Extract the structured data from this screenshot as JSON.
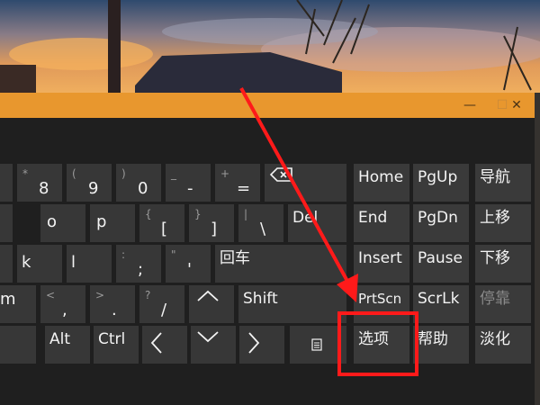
{
  "window": {
    "minimize": "—",
    "maximize": "☐",
    "close": "✕"
  },
  "keys": {
    "asterisk_8": {
      "top": "*",
      "main": "8"
    },
    "paren_9": {
      "top": "(",
      "main": "9"
    },
    "paren_0": {
      "top": ")",
      "main": "0"
    },
    "minus": {
      "top": "_",
      "main": "-"
    },
    "equals": {
      "top": "+",
      "main": "="
    },
    "o": "o",
    "p": "p",
    "bracket_left": {
      "top": "{",
      "main": "["
    },
    "bracket_right": {
      "top": "}",
      "main": "]"
    },
    "backslash": {
      "top": "|",
      "main": "\\"
    },
    "del": "Del",
    "k": "k",
    "l": "l",
    "semicolon": {
      "top": ":",
      "main": ";"
    },
    "quote": {
      "top": "\"",
      "main": "'"
    },
    "enter": "回车",
    "m": "m",
    "comma": {
      "top": "<",
      "main": ","
    },
    "period": {
      "top": ">",
      "main": "."
    },
    "slash": {
      "top": "?",
      "main": "/"
    },
    "shift": "Shift",
    "alt": "Alt",
    "ctrl": "Ctrl",
    "home": "Home",
    "pgup": "PgUp",
    "nav": "导航",
    "end": "End",
    "pgdn": "PgDn",
    "move_up": "上移",
    "insert": "Insert",
    "pause": "Pause",
    "move_down": "下移",
    "prtscn": "PrtScn",
    "scrlk": "ScrLk",
    "dock": "停靠",
    "options": "选项",
    "help": "帮助",
    "fade": "淡化"
  },
  "colors": {
    "titlebar": "#e8972e",
    "keyboard_bg": "#1f1f1f",
    "key_bg": "#373737",
    "annotation": "#ff1a1a"
  },
  "icons": [
    "backspace-icon",
    "arrow-up-icon",
    "arrow-down-icon",
    "arrow-left-icon",
    "arrow-right-icon",
    "menu-icon"
  ]
}
